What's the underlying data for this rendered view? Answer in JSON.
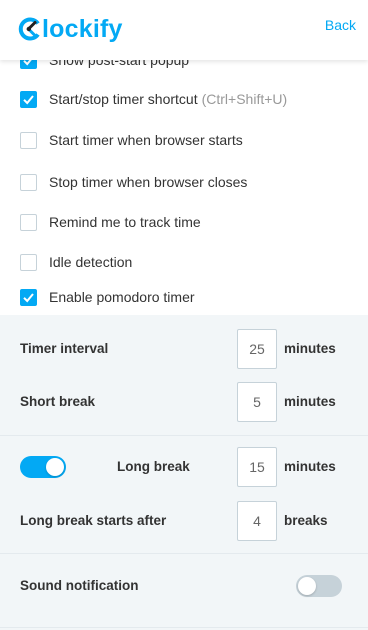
{
  "header": {
    "logo_text": "lockify",
    "back_label": "Back"
  },
  "checkboxes": [
    {
      "label": "Show post-start popup",
      "hint": "",
      "checked": true
    },
    {
      "label": "Start/stop timer shortcut",
      "hint": "(Ctrl+Shift+U)",
      "checked": true
    },
    {
      "label": "Start timer when browser starts",
      "hint": "",
      "checked": false
    },
    {
      "label": "Stop timer when browser closes",
      "hint": "",
      "checked": false
    },
    {
      "label": "Remind me to track time",
      "hint": "",
      "checked": false
    },
    {
      "label": "Idle detection",
      "hint": "",
      "checked": false
    },
    {
      "label": "Enable pomodoro timer",
      "hint": "",
      "checked": true
    }
  ],
  "pomodoro": {
    "timer_interval": {
      "label": "Timer interval",
      "value": "25",
      "unit": "minutes"
    },
    "short_break": {
      "label": "Short break",
      "value": "5",
      "unit": "minutes"
    },
    "long_break": {
      "label": "Long break",
      "value": "15",
      "unit": "minutes",
      "enabled": true
    },
    "long_break_after": {
      "label": "Long break starts after",
      "value": "4",
      "unit": "breaks"
    },
    "sound_notification": {
      "label": "Sound notification",
      "enabled": false
    }
  },
  "colors": {
    "accent": "#03a9f4",
    "section_bg": "#f2f6f8",
    "border": "#c6d2d9"
  }
}
